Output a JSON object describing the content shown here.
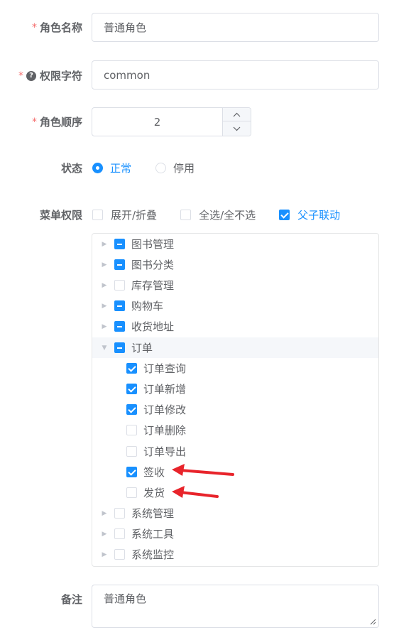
{
  "form": {
    "role_name": {
      "label": "角色名称",
      "required": "*",
      "value": "普通角色"
    },
    "role_key": {
      "label": "权限字符",
      "required": "*",
      "value": "common",
      "help_icon": "question-circle-icon"
    },
    "role_sort": {
      "label": "角色顺序",
      "required": "*",
      "value": "2",
      "up_icon": "chevron-up-icon",
      "down_icon": "chevron-down-icon"
    },
    "status": {
      "label": "状态",
      "options": [
        "正常",
        "停用"
      ],
      "selected": "正常"
    },
    "menu": {
      "label": "菜单权限",
      "toggles": [
        {
          "label": "展开/折叠",
          "checked": false
        },
        {
          "label": "全选/全不选",
          "checked": false
        },
        {
          "label": "父子联动",
          "checked": true
        }
      ],
      "tree": [
        {
          "label": "图书管理",
          "state": "partial",
          "expanded": false
        },
        {
          "label": "图书分类",
          "state": "partial",
          "expanded": false
        },
        {
          "label": "库存管理",
          "state": "unchecked",
          "expanded": false
        },
        {
          "label": "购物车",
          "state": "partial",
          "expanded": false
        },
        {
          "label": "收货地址",
          "state": "partial",
          "expanded": false
        },
        {
          "label": "订单",
          "state": "partial",
          "expanded": true
        },
        {
          "label": "订单查询",
          "state": "checked",
          "child": true
        },
        {
          "label": "订单新增",
          "state": "checked",
          "child": true
        },
        {
          "label": "订单修改",
          "state": "checked",
          "child": true
        },
        {
          "label": "订单删除",
          "state": "unchecked",
          "child": true
        },
        {
          "label": "订单导出",
          "state": "unchecked",
          "child": true
        },
        {
          "label": "签收",
          "state": "checked",
          "child": true
        },
        {
          "label": "发货",
          "state": "unchecked",
          "child": true
        },
        {
          "label": "系统管理",
          "state": "unchecked",
          "expanded": false
        },
        {
          "label": "系统工具",
          "state": "unchecked",
          "expanded": false
        },
        {
          "label": "系统监控",
          "state": "unchecked",
          "expanded": false
        }
      ]
    },
    "remark": {
      "label": "备注",
      "value": "普通角色"
    }
  },
  "colors": {
    "primary": "#1890ff",
    "required": "#f56c6c",
    "annotation_arrow": "#e8242b"
  }
}
